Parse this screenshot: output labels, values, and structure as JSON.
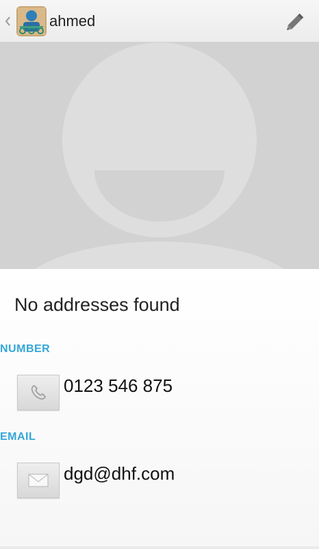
{
  "header": {
    "title": "ahmed",
    "back_icon": "chevron-left-icon",
    "avatar_icon": "contact-avatar-icon",
    "edit_icon": "pencil-icon"
  },
  "photo": {
    "icon": "default-contact-silhouette-icon"
  },
  "details": {
    "no_address_text": "No addresses found",
    "number_section": {
      "header": "NUMBER",
      "value": "0123 546 875",
      "icon": "phone-icon"
    },
    "email_section": {
      "header": "EMAIL",
      "value": "dgd@dhf.com",
      "icon": "envelope-icon"
    }
  },
  "colors": {
    "accent": "#33a7d9",
    "photo_background": "#d2d2d2",
    "silhouette": "#e0e0e0"
  }
}
